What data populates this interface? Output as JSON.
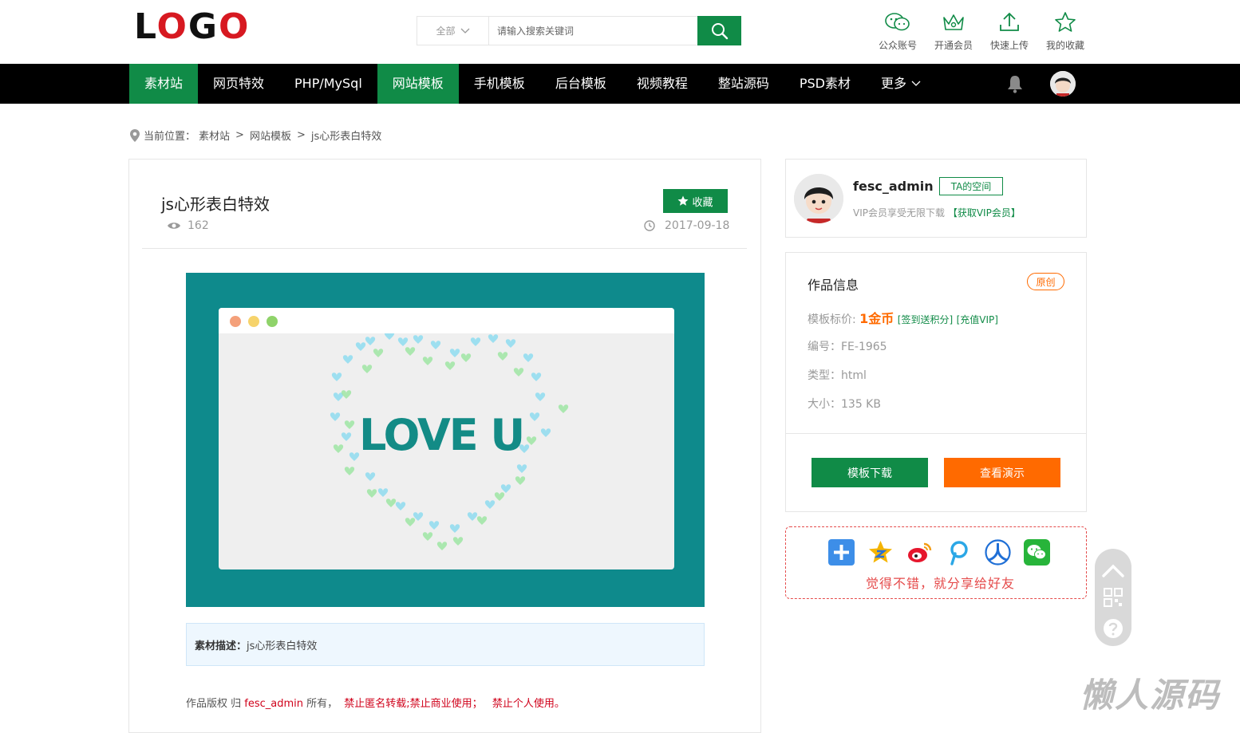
{
  "header": {
    "logo_prefix": "L",
    "logo_o1": "O",
    "logo_g": "G",
    "logo_o2": "O",
    "search_category": "全部",
    "search_placeholder": "请输入搜索关键词",
    "links": [
      {
        "icon": "wechat-icon",
        "label": "公众账号"
      },
      {
        "icon": "crown-icon",
        "label": "开通会员"
      },
      {
        "icon": "upload-icon",
        "label": "快速上传"
      },
      {
        "icon": "star-icon",
        "label": "我的收藏"
      }
    ]
  },
  "nav": {
    "items": [
      {
        "label": "素材站"
      },
      {
        "label": "网页特效"
      },
      {
        "label": "PHP/MySql"
      },
      {
        "label": "网站模板"
      },
      {
        "label": "手机模板"
      },
      {
        "label": "后台模板"
      },
      {
        "label": "视频教程"
      },
      {
        "label": "整站源码"
      },
      {
        "label": "PSD素材"
      },
      {
        "label": "更多"
      }
    ]
  },
  "breadcrumb": {
    "prefix": "当前位置：",
    "items": [
      "素材站",
      "网站模板",
      "js心形表白特效"
    ],
    "sep": ">"
  },
  "article": {
    "title": "js心形表白特效",
    "views": "162",
    "fav_label": "收藏",
    "date": "2017-09-18",
    "preview_text": "LOVE U",
    "desc_label": "素材描述：",
    "desc_value": "js心形表白特效",
    "copyright_a": "作品版权 归 ",
    "copyright_owner": "fesc_admin",
    "copyright_b": " 所有，",
    "copyright_c": "禁止匿名转载;禁止商业使用；",
    "copyright_d": "禁止个人使用。"
  },
  "author": {
    "name": "fesc_admin",
    "space_btn": "TA的空间",
    "vip_text": "VIP会员享受无限下载",
    "vip_link": "【获取VIP会员】"
  },
  "info": {
    "title": "作品信息",
    "badge": "原创",
    "price_label": "模板标价:",
    "price": "1金币",
    "price_link1": "[签到送积分]",
    "price_link2": "[充值VIP]",
    "id_label": "编号：",
    "id_value": "FE-1965",
    "type_label": "类型：",
    "type_value": "html",
    "size_label": "大小：",
    "size_value": "135 KB",
    "download": "模板下载",
    "demo": "查看演示"
  },
  "share": {
    "text": "觉得不错，就分享给好友",
    "icons": [
      "plus-share-icon",
      "qzone-icon",
      "weibo-icon",
      "pengyou-icon",
      "renren-icon",
      "wechat-share-icon"
    ]
  },
  "watermark": "懒人源码",
  "colors": {
    "brand_green": "#108b47",
    "orange": "#ff6a00",
    "red": "#d0021b",
    "teal": "#0e8a8c"
  }
}
